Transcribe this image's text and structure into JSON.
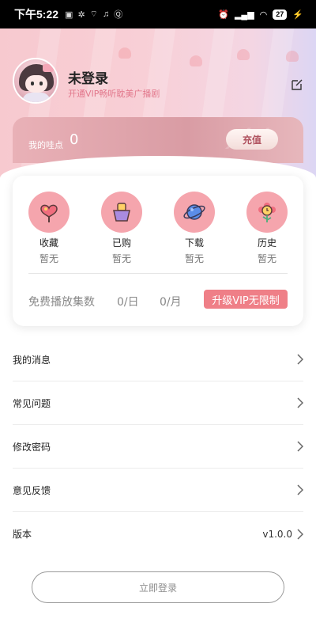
{
  "status_bar": {
    "time": "下午5:22",
    "notification_icons": [
      "chat-icon",
      "bug-icon",
      "signal-small-icon",
      "music-icon",
      "q-icon"
    ],
    "battery": "27"
  },
  "profile": {
    "username": "未登录",
    "subtitle": "开通VIP畅听耽美广播剧"
  },
  "points": {
    "label": "我的哇点",
    "value": "0",
    "recharge_label": "充值"
  },
  "features": [
    {
      "label": "收藏",
      "value": "暂无",
      "icon": "lollipop-icon"
    },
    {
      "label": "已购",
      "value": "暂无",
      "icon": "shopping-basket-icon"
    },
    {
      "label": "下载",
      "value": "暂无",
      "icon": "planet-icon"
    },
    {
      "label": "历史",
      "value": "暂无",
      "icon": "flower-clock-icon"
    }
  ],
  "free_play": {
    "label": "免费播放集数",
    "per_day": "0/日",
    "per_month": "0/月",
    "vip_button": "升级VIP无限制"
  },
  "menu": [
    {
      "label": "我的消息",
      "value": ""
    },
    {
      "label": "常见问题",
      "value": ""
    },
    {
      "label": "修改密码",
      "value": ""
    },
    {
      "label": "意见反馈",
      "value": ""
    },
    {
      "label": "版本",
      "value": "v1.0.0"
    }
  ],
  "login_button": "立即登录",
  "colors": {
    "accent": "#ef7f87",
    "icon_circle": "#f5a5ad",
    "subtitle": "#e2788c"
  }
}
